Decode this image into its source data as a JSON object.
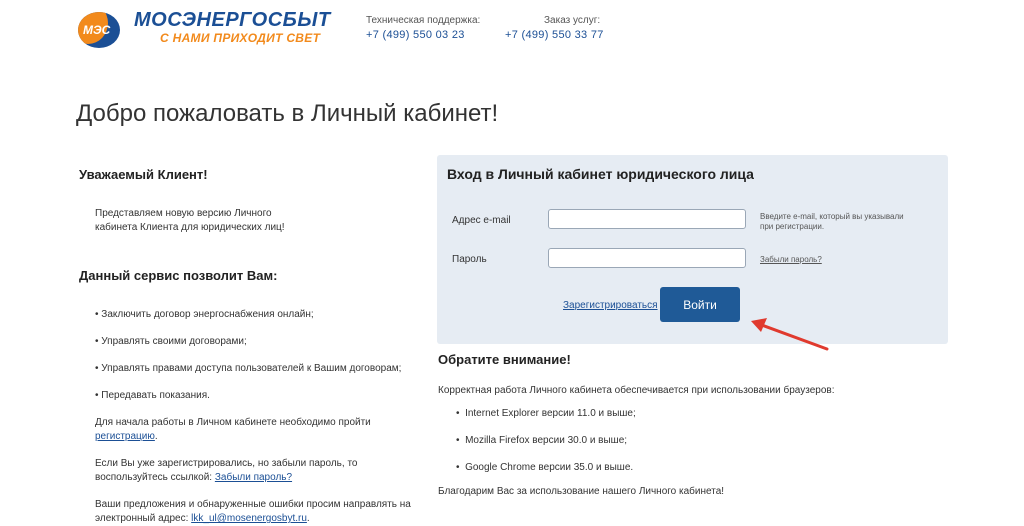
{
  "header": {
    "logo_abbr": "МЭС",
    "brand_title": "МОСЭНЕРГОСБЫТ",
    "brand_slogan": "С НАМИ ПРИХОДИТ СВЕТ",
    "support_label": "Техническая поддержка:",
    "support_phone": "+7 (499) 550 03 23",
    "order_label": "Заказ услуг:",
    "order_phone": "+7 (499) 550 33 77"
  },
  "page_title": "Добро пожаловать в Личный кабинет!",
  "left": {
    "greeting": "Уважаемый Клиент!",
    "intro_line1": "Представляем новую версию Личного",
    "intro_line2": "кабинета Клиента для юридических лиц!",
    "service_heading": "Данный сервис позволит Вам:",
    "features": [
      "• Заключить договор энергоснабжения онлайн;",
      "• Управлять своими договорами;",
      "• Управлять правами доступа пользователей к Вашим договорам;",
      "• Передавать показания."
    ],
    "start_line1": "Для начала работы в Личном кабинете необходимо пройти",
    "start_link": "регистрацию",
    "start_tail": ".",
    "forgot_line1": "Если Вы уже зарегистрировались, но забыли пароль, то",
    "forgot_prefix": "воспользуйтесь ссылкой: ",
    "forgot_link": "Забыли пароль?",
    "suggest_line1": "Ваши предложения и обнаруженные ошибки просим направлять на",
    "suggest_prefix": "электронный адрес: ",
    "suggest_email": "lkk_ul@mosenergosbyt.ru",
    "suggest_tail": "."
  },
  "login": {
    "title": "Вход в Личный кабинет юридического лица",
    "email_label": "Адрес e-mail",
    "email_value": "",
    "email_hint_line1": "Введите e-mail, который вы указывали",
    "email_hint_line2": "при регистрации.",
    "password_label": "Пароль",
    "password_value": "",
    "forgot_link": "Забыли пароль?",
    "register_link": "Зарегистрироваться",
    "submit": "Войти"
  },
  "notice": {
    "heading": "Обратите внимание!",
    "intro": "Корректная работа Личного кабинета обеспечивается при использовании браузеров:",
    "browsers": [
      "Internet Explorer версии 11.0 и выше;",
      "Mozilla Firefox версии 30.0 и выше;",
      "Google Chrome версии 35.0 и выше."
    ],
    "thanks": "Благодарим Вас за использование нашего Личного кабинета!"
  },
  "colors": {
    "brand_blue": "#1b4f95",
    "brand_orange": "#f28a1c",
    "button": "#1f5a97",
    "panel": "#e6ecf3",
    "arrow": "#e03a2e"
  }
}
